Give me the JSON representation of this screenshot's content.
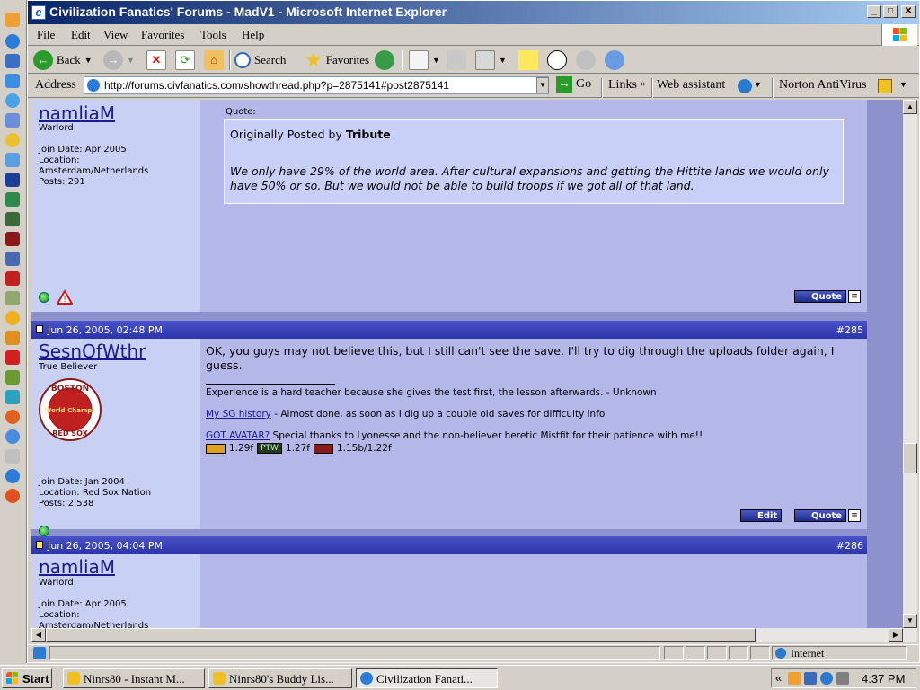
{
  "window": {
    "title": "Civilization Fanatics' Forums - MadV1 - Microsoft Internet Explorer",
    "minimize": "_",
    "maximize": "□",
    "close": "✕"
  },
  "menu": [
    "File",
    "Edit",
    "View",
    "Favorites",
    "Tools",
    "Help"
  ],
  "toolbar": {
    "back": "Back",
    "search": "Search",
    "favorites": "Favorites"
  },
  "address": {
    "label": "Address",
    "url": "http://forums.civfanatics.com/showthread.php?p=2875141#post2875141",
    "go": "Go",
    "links": "Links",
    "links_more": "»",
    "web_assistant": "Web assistant",
    "norton": "Norton AntiVirus"
  },
  "posts": {
    "p1": {
      "username": "namliaM",
      "user_title": "Warlord",
      "join_date": "Join Date: Apr 2005",
      "location_label": "Location:",
      "location": "Amsterdam/Netherlands",
      "posts": "Posts: 291",
      "quote_label": "Quote:",
      "quote_by_prefix": "Originally Posted by",
      "quote_author": "Tribute",
      "quote_text": "We only have 29% of the world area. After cultural expansions and getting the Hittite lands we would only have 50% or so. But we would not be able to build troops if we got all of that land.",
      "quote_button": "Quote"
    },
    "p2": {
      "date": "Jun 26, 2005, 02:48 PM",
      "number": "#285",
      "username": "SesnOfWthr",
      "user_title": "True Believer",
      "join_date": "Join Date: Jan 2004",
      "location": "Location: Red Sox Nation",
      "posts": "Posts: 2,538",
      "avatar_text_top": "BOSTON",
      "avatar_text_mid": "World Champs",
      "avatar_text_bottom": "RED SOX",
      "message": "OK, you guys may not believe this, but I still can't see the save. I'll try to dig through the uploads folder again, I guess.",
      "sig_line1": "Experience is a hard teacher because she gives the test first, the lesson afterwards. - Unknown",
      "sig_link1": "My SG history",
      "sig_line2": " - Almost done, as soon as I dig up a couple old saves for difficulty info",
      "sig_link2": "GOT AVATAR?",
      "sig_line3": " Special thanks to Lyonesse and the non-believer heretic Mistfit for their patience with me!!",
      "badge1": "1.29f",
      "badge2_label": "PTW",
      "badge2": "1.27f",
      "badge3": "1.15b/1.22f",
      "edit_button": "Edit",
      "quote_button": "Quote"
    },
    "p3": {
      "date": "Jun 26, 2005, 04:04 PM",
      "number": "#286",
      "username": "namliaM",
      "user_title": "Warlord",
      "join_date": "Join Date: Apr 2005",
      "location_label": "Location:",
      "location": "Amsterdam/Netherlands"
    }
  },
  "status": {
    "zone": "Internet"
  },
  "taskbar": {
    "start": "Start",
    "tasks": [
      "Ninrs80 - Instant M...",
      "Ninrs80's Buddy Lis...",
      "Civilization Fanati..."
    ],
    "time": "4:37 PM",
    "tray_chevron": "«"
  },
  "colors": {
    "title_start": "#0a246a",
    "post_header": "#2b34a8",
    "user_pane": "#c8d0f4",
    "message_pane": "#b3b8e8",
    "link": "#1c1c8c"
  }
}
